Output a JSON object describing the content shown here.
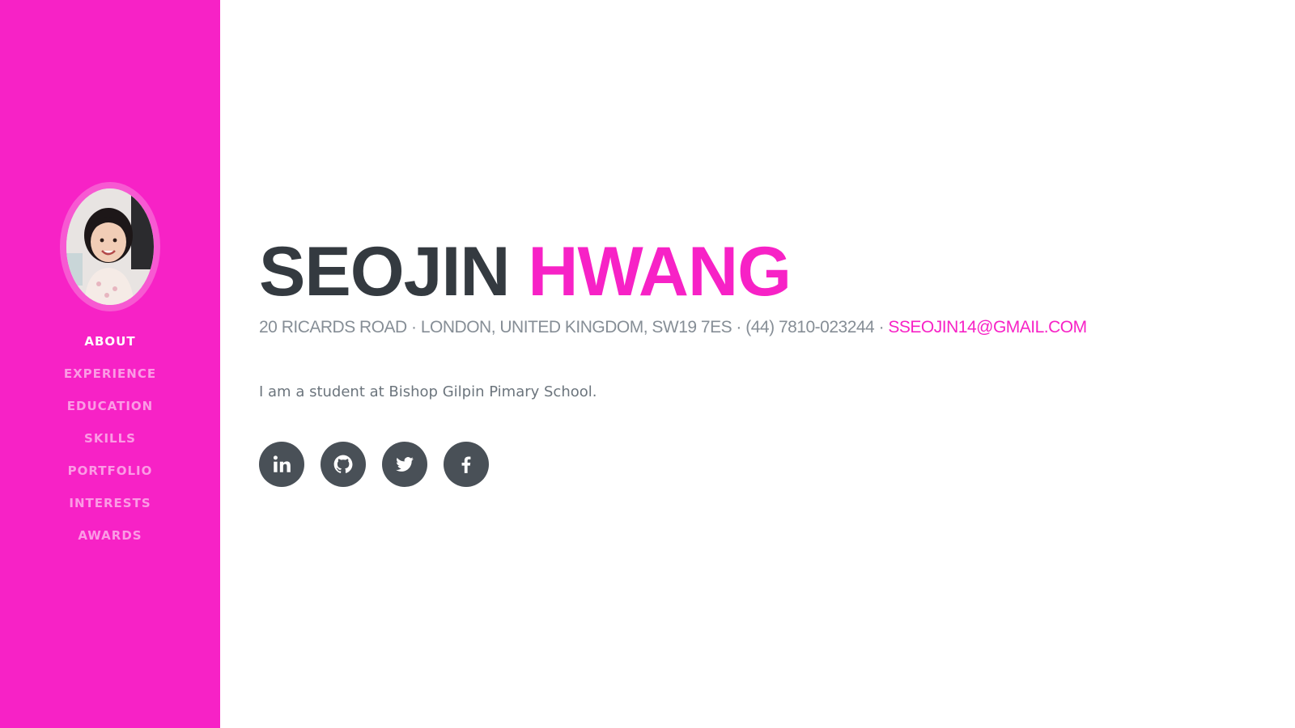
{
  "sidebar": {
    "avatar_icon": "profile-photo",
    "nav": [
      {
        "label": "ABOUT",
        "active": true
      },
      {
        "label": "EXPERIENCE"
      },
      {
        "label": "EDUCATION"
      },
      {
        "label": "SKILLS"
      },
      {
        "label": "PORTFOLIO"
      },
      {
        "label": "INTERESTS"
      },
      {
        "label": "AWARDS"
      }
    ]
  },
  "about": {
    "first_name": "SEOJIN",
    "last_name": "HWANG",
    "address": "20 RICARDS ROAD · LONDON, UNITED KINGDOM, SW19 7ES · (44) 7810-023244 ·",
    "email": "SSEOJIN14@GMAIL.COM",
    "bio": "I am a student at Bishop Gilpin Pimary School."
  },
  "social": {
    "icons": [
      "linkedin-icon",
      "github-icon",
      "twitter-icon",
      "facebook-icon"
    ]
  },
  "colors": {
    "accent": "#f722c6",
    "dark": "#343a40",
    "muted": "#868e96",
    "social_bg": "#495057"
  }
}
